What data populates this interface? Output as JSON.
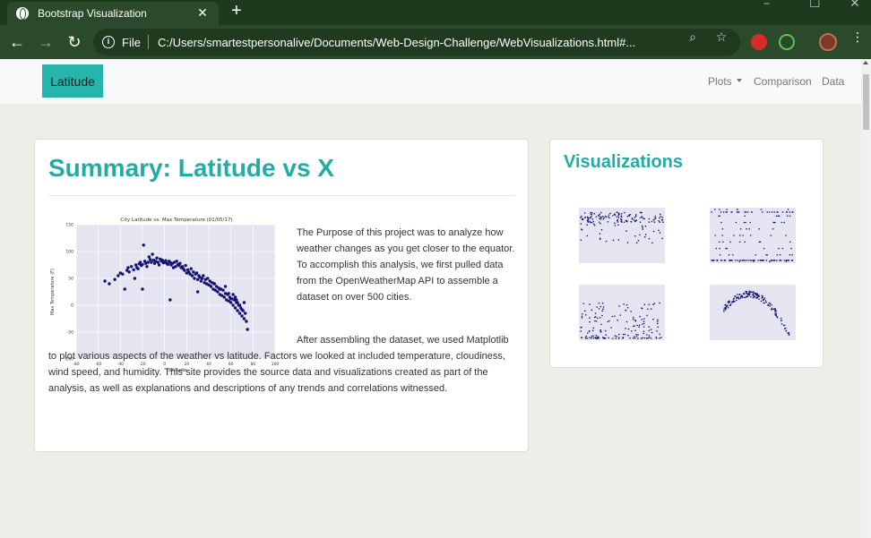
{
  "browser": {
    "tab_title": "Bootstrap Visualization",
    "tab_close": "✕",
    "new_tab": "+",
    "window_controls": [
      "–",
      "☐",
      "✕"
    ],
    "file_label": "File",
    "url": "C:/Users/smartestpersonalive/Documents/Web-Design-Challenge/WebVisualizations.html#..."
  },
  "navbar": {
    "brand": "Latitude",
    "links": [
      {
        "label": "Plots",
        "dropdown": true
      },
      {
        "label": "Comparison",
        "dropdown": false
      },
      {
        "label": "Data",
        "dropdown": false
      }
    ]
  },
  "summary": {
    "title": "Summary: Latitude vs X",
    "paragraph_1": "The Purpose of this project was to analyze how weather changes as you get closer to the equator. To accomplish this analysis, we first pulled data from the OpenWeatherMap API to assemble a dataset on over 500 cities.",
    "paragraph_2": "After assembling the dataset, we used Matplotlib to plot various aspects of the weather vs latitude. Factors we looked at included temperature, cloudiness, wind speed, and humidity. This site provides the source data and visualizations created as part of the analysis, as well as explanations and descriptions of any trends and correlations witnessed."
  },
  "visualizations": {
    "title": "Visualizations",
    "thumbnails": [
      "humidity",
      "cloudiness",
      "wind-speed",
      "max-temperature"
    ]
  },
  "chart_data": {
    "type": "scatter",
    "title": "City Latitude vs. Max Temperature (01/05/17)",
    "xlabel": "Latitude",
    "ylabel": "Max Temperature (F)",
    "xlim": [
      -80,
      100
    ],
    "ylim": [
      -100,
      150
    ],
    "xticks": [
      -80,
      -60,
      -40,
      -20,
      0,
      20,
      40,
      60,
      80,
      100
    ],
    "yticks": [
      -100,
      -50,
      0,
      50,
      100,
      150
    ],
    "grid": true,
    "point_color": "#14146e",
    "background": "#e5e5f2",
    "x": [
      -54,
      -50,
      -45,
      -42,
      -40,
      -38,
      -36,
      -34,
      -33,
      -32,
      -30,
      -28,
      -27,
      -26,
      -25,
      -24,
      -23,
      -22,
      -21,
      -20,
      -19,
      -18,
      -17,
      -16,
      -15,
      -14,
      -13,
      -12,
      -11,
      -10,
      -9,
      -8,
      -7,
      -6,
      -5,
      -4,
      -3,
      -2,
      -1,
      0,
      1,
      2,
      3,
      4,
      5,
      6,
      7,
      8,
      9,
      10,
      11,
      12,
      13,
      14,
      15,
      16,
      17,
      18,
      19,
      20,
      21,
      22,
      23,
      24,
      25,
      26,
      27,
      28,
      29,
      30,
      31,
      32,
      33,
      34,
      35,
      36,
      37,
      38,
      39,
      40,
      41,
      42,
      43,
      44,
      45,
      46,
      47,
      48,
      49,
      50,
      51,
      52,
      53,
      54,
      55,
      56,
      57,
      58,
      59,
      60,
      61,
      62,
      63,
      64,
      65,
      66,
      67,
      68,
      69,
      70,
      71,
      72,
      73,
      74,
      75,
      62,
      64,
      66,
      68,
      70,
      -20,
      5,
      30,
      55,
      45,
      50,
      58,
      65,
      72,
      60
    ],
    "y": [
      45,
      40,
      48,
      55,
      60,
      58,
      30,
      65,
      70,
      62,
      72,
      66,
      50,
      75,
      70,
      68,
      77,
      80,
      74,
      76,
      112,
      82,
      78,
      72,
      80,
      90,
      85,
      80,
      95,
      84,
      78,
      82,
      88,
      80,
      75,
      86,
      82,
      84,
      79,
      80,
      83,
      78,
      76,
      82,
      80,
      75,
      78,
      70,
      80,
      72,
      82,
      76,
      74,
      78,
      70,
      72,
      68,
      65,
      74,
      60,
      66,
      62,
      58,
      68,
      55,
      62,
      50,
      58,
      60,
      48,
      55,
      52,
      45,
      50,
      55,
      42,
      48,
      40,
      50,
      38,
      45,
      35,
      42,
      30,
      40,
      28,
      35,
      25,
      32,
      20,
      30,
      18,
      28,
      15,
      22,
      10,
      20,
      8,
      15,
      5,
      12,
      0,
      10,
      -5,
      5,
      -10,
      0,
      -15,
      -5,
      -20,
      -10,
      -25,
      -15,
      -30,
      -45,
      20,
      15,
      5,
      0,
      -8,
      30,
      10,
      25,
      35,
      40,
      30,
      22,
      10,
      5,
      12
    ]
  }
}
